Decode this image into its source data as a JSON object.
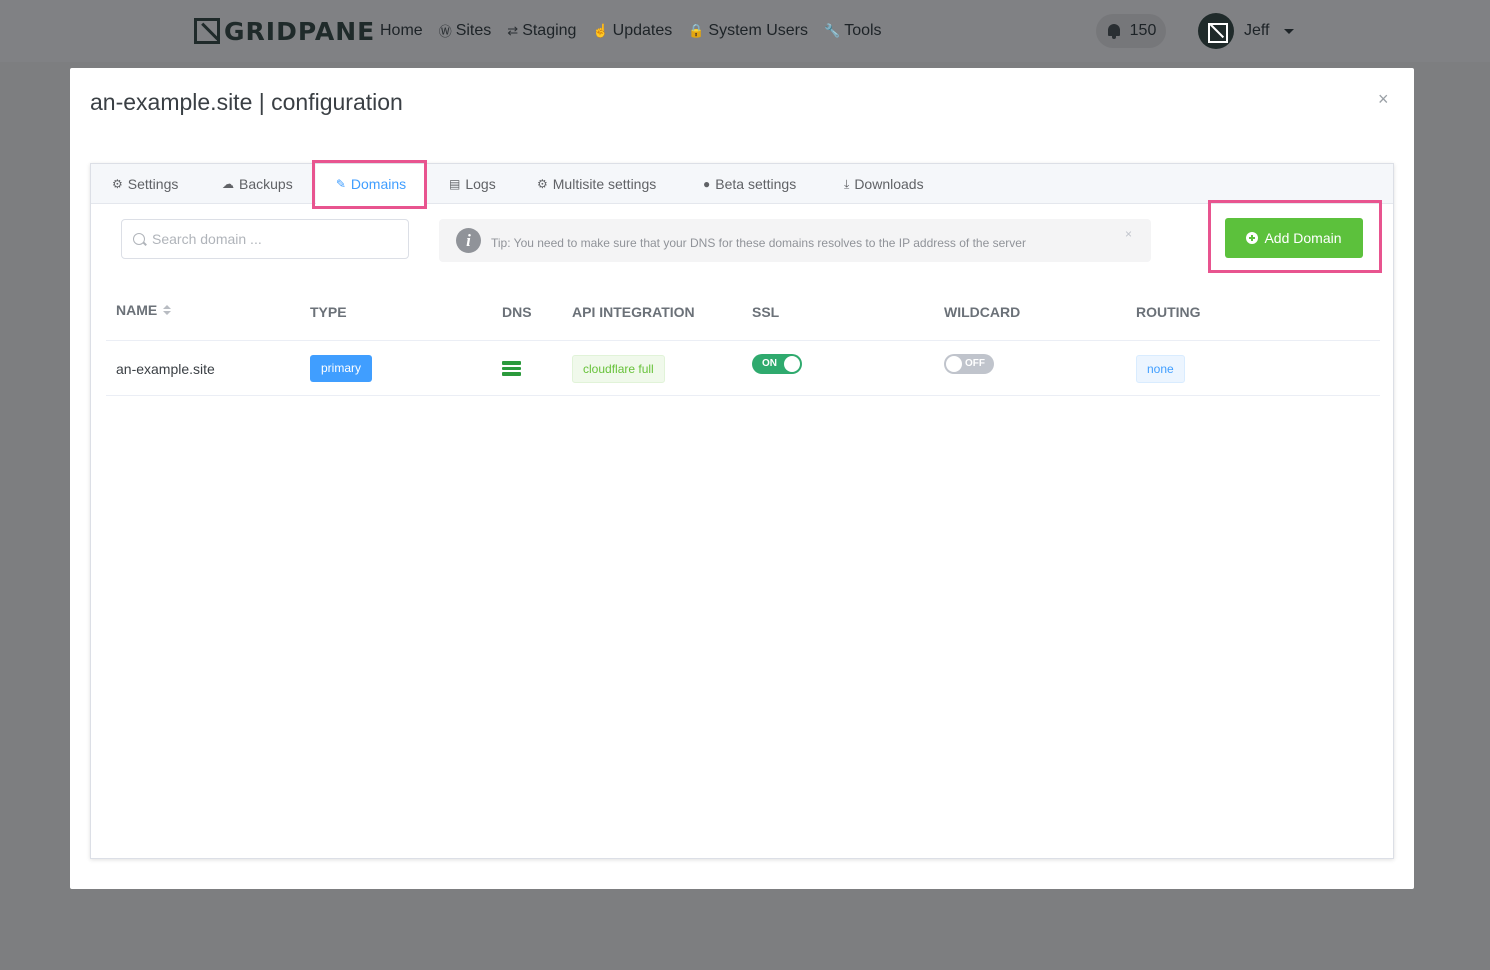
{
  "nav": {
    "logo": "GRIDPANE",
    "links": [
      {
        "label": "Home",
        "icon": ""
      },
      {
        "label": "Sites",
        "icon": "wordpress-icon"
      },
      {
        "label": "Staging",
        "icon": "sync-icon"
      },
      {
        "label": "Updates",
        "icon": "thumbs-up-icon"
      },
      {
        "label": "System Users",
        "icon": "user-lock-icon"
      },
      {
        "label": "Tools",
        "icon": "wrench-icon"
      }
    ],
    "notifications": "150",
    "user": "Jeff"
  },
  "modal": {
    "title": "an-example.site | configuration",
    "close": "×"
  },
  "tabs": [
    {
      "label": "Settings",
      "icon": "gear-icon"
    },
    {
      "label": "Backups",
      "icon": "cloud-upload-icon"
    },
    {
      "label": "Domains",
      "icon": "edit-icon",
      "active": true
    },
    {
      "label": "Logs",
      "icon": "document-icon"
    },
    {
      "label": "Multisite settings",
      "icon": "gear-icon"
    },
    {
      "label": "Beta settings",
      "icon": "alert-circle-icon"
    },
    {
      "label": "Downloads",
      "icon": "download-icon"
    }
  ],
  "search": {
    "placeholder": "Search domain ..."
  },
  "tip": {
    "text": "Tip: You need to make sure that your DNS for these domains resolves to the IP address of the server",
    "close": "×"
  },
  "add_button": {
    "label": "Add Domain"
  },
  "table": {
    "columns": [
      "NAME",
      "TYPE",
      "DNS",
      "API INTEGRATION",
      "SSL",
      "WILDCARD",
      "ROUTING"
    ],
    "rows": [
      {
        "name": "an-example.site",
        "type": "primary",
        "api": "cloudflare full",
        "ssl": "ON",
        "wildcard": "OFF",
        "routing": "none"
      }
    ]
  },
  "colors": {
    "accent": "#409eff",
    "success": "#5cc13c",
    "highlight": "#e8548f"
  }
}
